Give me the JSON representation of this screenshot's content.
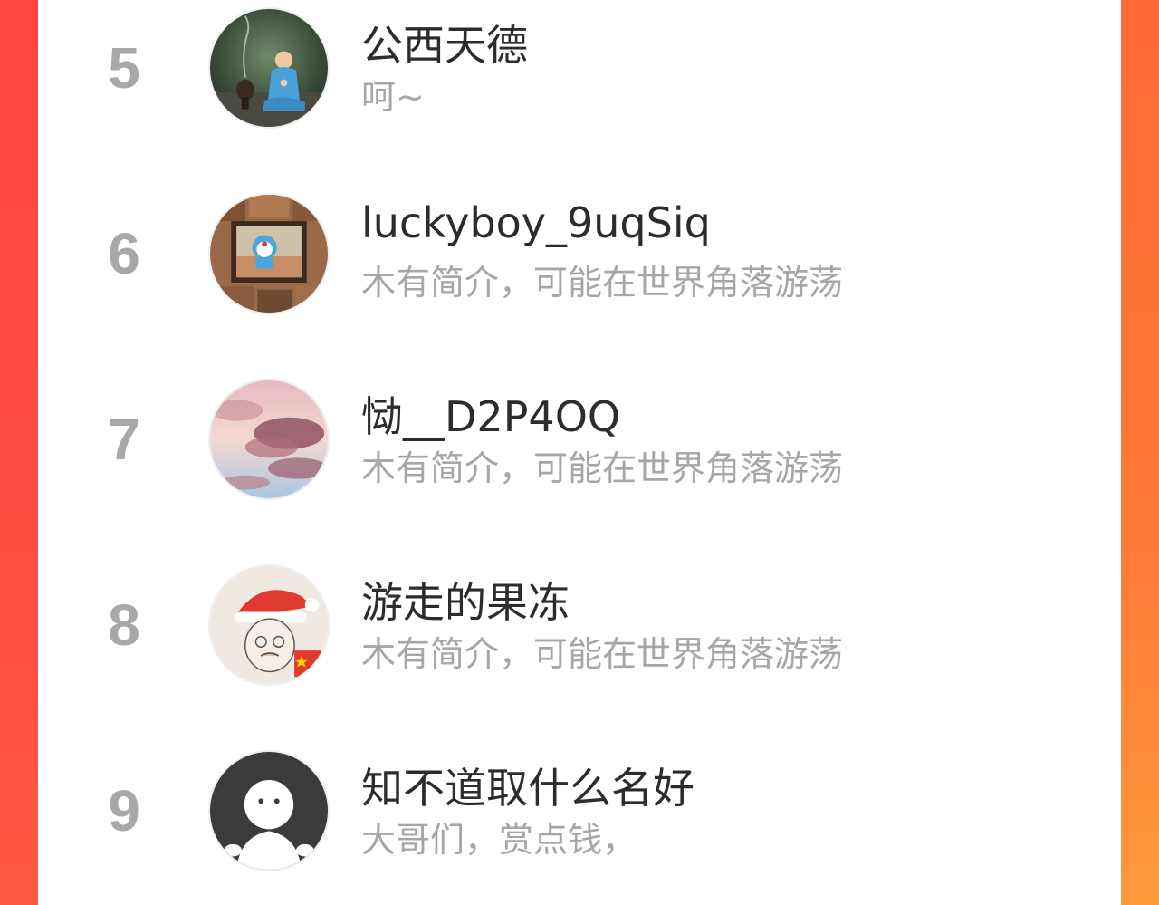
{
  "colors": {
    "accent_left": "#ff4643",
    "accent_right": "#ff7a37",
    "rank_gray": "#a8a8a8",
    "name_text": "#2c2c2c",
    "bio_text": "#a6a6a6"
  },
  "ranking_list": {
    "items": [
      {
        "rank": "5",
        "name": "公西天德",
        "bio": "呵~",
        "avatar_icon": "child-meditating-avatar"
      },
      {
        "rank": "6",
        "name": "luckyboy_9uqSiq",
        "bio": "木有简介，可能在世界角落游荡",
        "avatar_icon": "framed-cartoon-avatar"
      },
      {
        "rank": "7",
        "name": "恸__D2P4OQ",
        "bio": "木有简介，可能在世界角落游荡",
        "avatar_icon": "pink-clouds-avatar"
      },
      {
        "rank": "8",
        "name": "游走的果冻",
        "bio": "木有简介，可能在世界角落游荡",
        "avatar_icon": "santa-hat-sketch-avatar"
      },
      {
        "rank": "9",
        "name": "知不道取什么名好",
        "bio": "大哥们，赏点钱，",
        "avatar_icon": "default-user-avatar"
      }
    ]
  }
}
